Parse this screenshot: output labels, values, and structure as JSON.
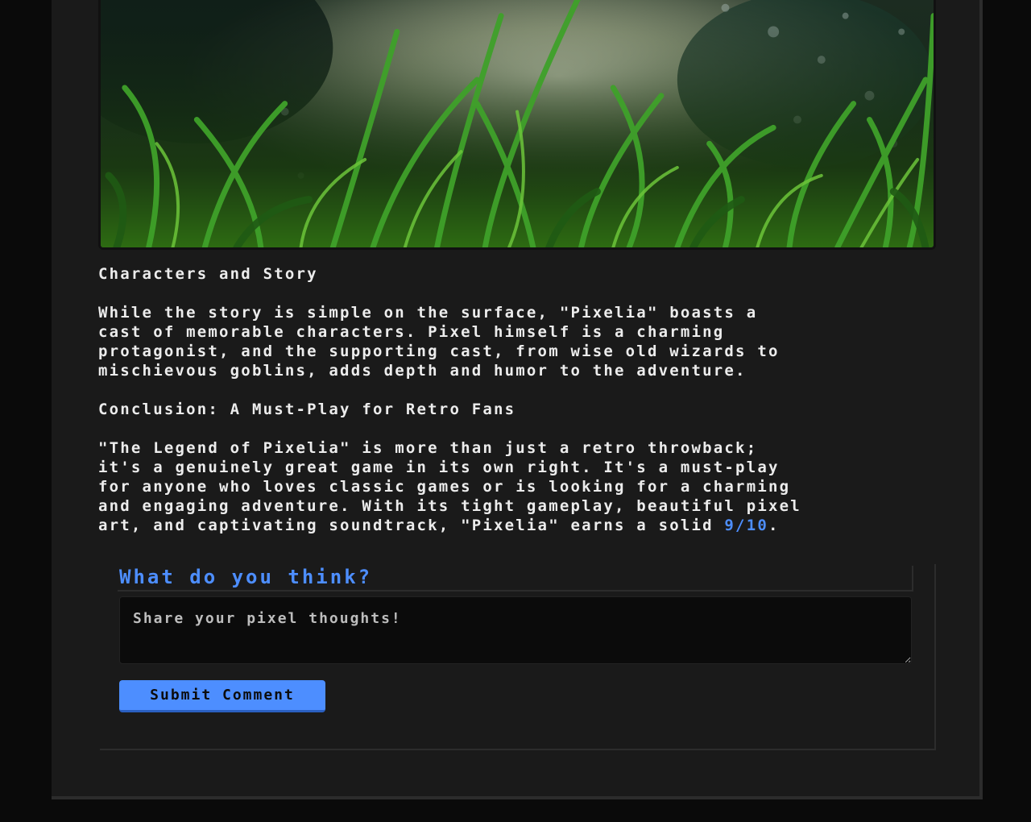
{
  "article": {
    "section_heading_story": "Characters and Story",
    "story_paragraph": "While the story is simple on the surface, \"Pixelia\" boasts a\ncast of memorable characters. Pixel himself is a charming\nprotagonist, and the supporting cast, from wise old wizards to\nmischievous goblins, adds depth and humor to the adventure.",
    "section_heading_conclusion": "Conclusion: A Must-Play for Retro Fans",
    "conclusion_paragraph": "\"The Legend of Pixelia\" is more than just a retro throwback;\nit's a genuinely great game in its own right. It's a must-play\nfor anyone who loves classic games or is looking for a charming\nand engaging adventure. With its tight gameplay, beautiful pixel\nart, and captivating soundtrack, \"Pixelia\" earns a solid ",
    "score": "9/10",
    "score_suffix": "."
  },
  "comments": {
    "title": "What do you think?",
    "placeholder": "Share your pixel thoughts!",
    "value": "",
    "submit_label": "Submit Comment"
  },
  "colors": {
    "accent": "#4d8eff",
    "page_background": "#0a0a0a",
    "card_background": "#1a1a1a",
    "text": "#ececec"
  },
  "icons": {
    "hero_image": "grass-photo"
  }
}
